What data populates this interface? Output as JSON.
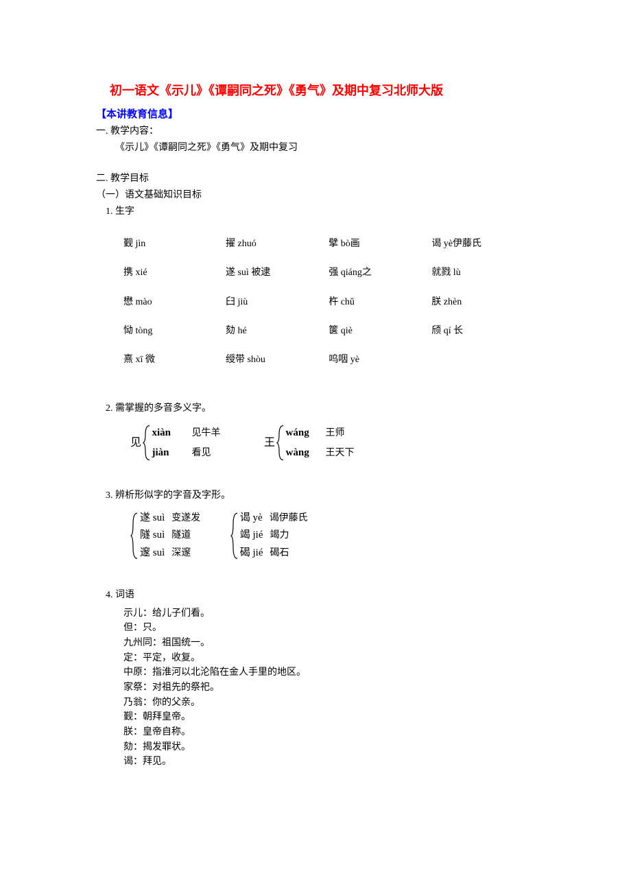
{
  "title": "初一语文《示儿》《谭嗣同之死》《勇气》及期中复习北师大版",
  "section_head": "【本讲教育信息】",
  "sec1_title": "一. 教学内容：",
  "sec1_body": "《示儿》《谭嗣同之死》《勇气》及期中复习",
  "sec2_title": "二. 教学目标",
  "sec2_sub1": "（一）语文基础知识目标",
  "s1_heading": "1. 生字",
  "char_rows": [
    [
      "觐 jìn",
      "擢 zhuó",
      "擘 bò画",
      "谒 yè伊藤氏"
    ],
    [
      "携 xié",
      "遂 suì 被逮",
      "强 qiáng之",
      "就戮 lù"
    ],
    [
      "懋 mào",
      "臼 jiù",
      "杵 chǔ",
      "朕 zhèn"
    ],
    [
      "恸 tòng",
      "劾 hé",
      "箧 qiè",
      "颀 qí 长"
    ],
    [
      "熹 xī 微",
      "绶带 shòu",
      "呜咽 yè",
      ""
    ]
  ],
  "s2_heading": "2. 需掌握的多音多义字。",
  "poly": [
    {
      "char": "见",
      "items": [
        {
          "py": "xiàn",
          "mean": "见牛羊"
        },
        {
          "py": "jiàn",
          "mean": "看见"
        }
      ]
    },
    {
      "char": "王",
      "items": [
        {
          "py": "wáng",
          "mean": "王师"
        },
        {
          "py": "wàng",
          "mean": "王天下"
        }
      ]
    }
  ],
  "s3_heading": "3. 辨析形似字的字音及字形。",
  "simgroups": [
    [
      {
        "txt": "遂 suì",
        "mean": "变遂发"
      },
      {
        "txt": "隧 suì",
        "mean": "隧道"
      },
      {
        "txt": "邃 suì",
        "mean": "深邃"
      }
    ],
    [
      {
        "txt": "谒 yè",
        "mean": "谒伊藤氏"
      },
      {
        "txt": "竭 jié",
        "mean": "竭力"
      },
      {
        "txt": "碣 jié",
        "mean": "碣石"
      }
    ]
  ],
  "s4_heading": "4. 词语",
  "vocab": [
    "示儿：给儿子们看。",
    "但：只。",
    "九州同：祖国统一。",
    "定：平定，收复。",
    "中原：指淮河以北沦陷在金人手里的地区。",
    "家祭：对祖先的祭祀。",
    "乃翁：你的父亲。",
    "觐：朝拜皇帝。",
    "朕：皇帝自称。",
    "劾：揭发罪状。",
    "谒：拜见。"
  ]
}
